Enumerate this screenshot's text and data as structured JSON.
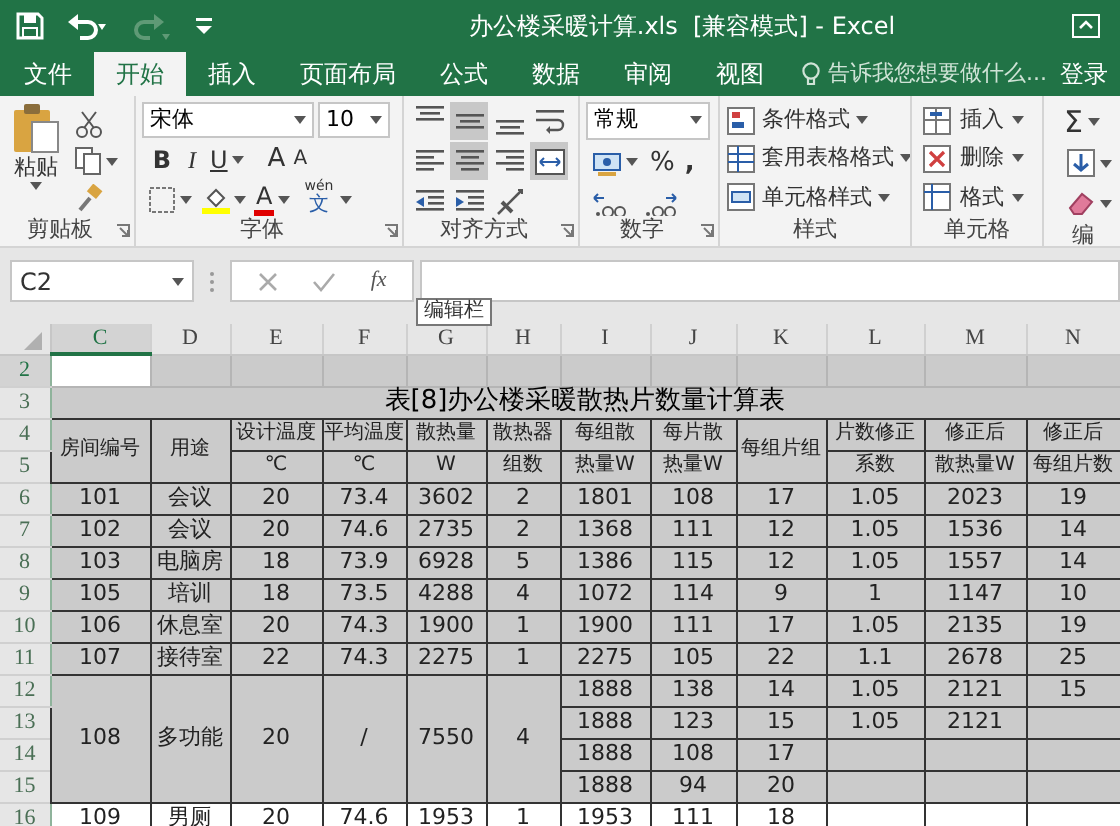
{
  "title_bar": {
    "title": "办公楼采暖计算.xls  [兼容模式] - Excel",
    "quick_access": [
      {
        "kind": "save",
        "disabled": false
      },
      {
        "kind": "undo",
        "disabled": false
      },
      {
        "kind": "redo",
        "disabled": true
      },
      {
        "kind": "customize",
        "disabled": false
      }
    ]
  },
  "tabs": [
    {
      "label": "文件",
      "selected": false
    },
    {
      "label": "开始",
      "selected": true
    },
    {
      "label": "插入",
      "selected": false
    },
    {
      "label": "页面布局",
      "selected": false
    },
    {
      "label": "公式",
      "selected": false
    },
    {
      "label": "数据",
      "selected": false
    },
    {
      "label": "审阅",
      "selected": false
    },
    {
      "label": "视图",
      "selected": false
    }
  ],
  "tell_me": {
    "placeholder": "告诉我您想要做什么..."
  },
  "sign_in": "登录",
  "ribbon": {
    "clipboard": {
      "label": "剪贴板",
      "paste": "粘贴"
    },
    "font": {
      "label": "字体",
      "name": "宋体",
      "size": "10",
      "bold": "B",
      "italic": "I",
      "underline": "U",
      "grow": "A",
      "shrink": "A",
      "font_color": "A",
      "phonetic_top": "wén",
      "phonetic_bottom": "文"
    },
    "alignment": {
      "label": "对齐方式",
      "buttons": [
        {
          "kind": "top",
          "selected": false
        },
        {
          "kind": "middle",
          "selected": true
        },
        {
          "kind": "bottom",
          "selected": false
        },
        {
          "kind": "wrap",
          "selected": false
        },
        {
          "kind": "left",
          "selected": false
        },
        {
          "kind": "center",
          "selected": true
        },
        {
          "kind": "right",
          "selected": false
        },
        {
          "kind": "merge",
          "selected": true
        },
        {
          "kind": "outdent",
          "selected": false
        },
        {
          "kind": "indent",
          "selected": false
        },
        {
          "kind": "orientation",
          "selected": false
        }
      ]
    },
    "number": {
      "label": "数字",
      "format": "常规",
      "percent": "%",
      "comma": ","
    },
    "styles": {
      "label": "样式",
      "items": [
        "条件格式",
        "套用表格格式",
        "单元格样式"
      ]
    },
    "cells": {
      "label": "单元格",
      "items": [
        "插入",
        "删除",
        "格式"
      ]
    },
    "editing": {
      "label": "编",
      "sum": "Σ"
    }
  },
  "formula_bar": {
    "name_box": "C2",
    "function_label": "fx"
  },
  "tooltip": "编辑栏",
  "sheet": {
    "columns": [
      "C",
      "D",
      "E",
      "F",
      "G",
      "H",
      "I",
      "J",
      "K",
      "L",
      "M",
      "N"
    ],
    "rows": [
      {
        "number": "2",
        "kind": "blank",
        "shaded": true,
        "cells": [
          {
            "selected": true
          },
          {
            "selected": false
          },
          {
            "selected": false
          },
          {
            "selected": false
          },
          {
            "selected": false
          },
          {
            "selected": false
          },
          {
            "selected": false
          },
          {
            "selected": false
          },
          {
            "selected": false
          },
          {
            "selected": false
          },
          {
            "selected": false
          },
          {
            "selected": false
          }
        ]
      },
      {
        "number": "3",
        "kind": "title",
        "shaded": true,
        "text": "表[8]办公楼采暖散热片数量计算表"
      },
      {
        "number": "4",
        "kind": "header",
        "shaded": true,
        "cells": [
          "房间编号",
          "用途",
          "设计温度",
          "平均温度",
          "散热量",
          "散热器",
          "每组散",
          "每片散",
          "每组片组",
          "片数修正",
          "修正后",
          "修正后"
        ]
      },
      {
        "number": "5",
        "kind": "header",
        "shaded": true,
        "cells": [
          {
            "merged": true
          },
          {
            "merged": true
          },
          "℃",
          "℃",
          "W",
          "组数",
          "热量W",
          "热量W",
          {
            "merged": true
          },
          "系数",
          "散热量W",
          "每组片数"
        ]
      },
      {
        "number": "6",
        "kind": "data",
        "shaded": true,
        "cells": [
          "101",
          "会议",
          "20",
          "73.4",
          "3602",
          "2",
          "1801",
          "108",
          "17",
          "1.05",
          "2023",
          "19"
        ]
      },
      {
        "number": "7",
        "kind": "data",
        "shaded": true,
        "cells": [
          "102",
          "会议",
          "20",
          "74.6",
          "2735",
          "2",
          "1368",
          "111",
          "12",
          "1.05",
          "1536",
          "14"
        ]
      },
      {
        "number": "8",
        "kind": "data",
        "shaded": true,
        "cells": [
          "103",
          "电脑房",
          "18",
          "73.9",
          "6928",
          "5",
          "1386",
          "115",
          "12",
          "1.05",
          "1557",
          "14"
        ]
      },
      {
        "number": "9",
        "kind": "data",
        "shaded": true,
        "cells": [
          "105",
          "培训",
          "18",
          "73.5",
          "4288",
          "4",
          "1072",
          "114",
          "9",
          "1",
          "1147",
          "10"
        ]
      },
      {
        "number": "10",
        "kind": "data",
        "shaded": true,
        "cells": [
          "106",
          "休息室",
          "20",
          "74.3",
          "1900",
          "1",
          "1900",
          "111",
          "17",
          "1.05",
          "2135",
          "19"
        ]
      },
      {
        "number": "11",
        "kind": "data",
        "shaded": true,
        "cells": [
          "107",
          "接待室",
          "22",
          "74.3",
          "2275",
          "1",
          "2275",
          "105",
          "22",
          "1.1",
          "2678",
          "25"
        ]
      },
      {
        "number": "12",
        "kind": "data",
        "shaded": true,
        "cells": [
          "108",
          "多功能",
          "20",
          "/",
          "7550",
          "4",
          "1888",
          "138",
          "14",
          "1.05",
          "2121",
          "15"
        ]
      },
      {
        "number": "13",
        "kind": "data",
        "shaded": true,
        "cells": [
          {
            "merged": true
          },
          {
            "merged": true
          },
          {
            "merged": true
          },
          {
            "merged": true
          },
          {
            "merged": true
          },
          {
            "merged": true
          },
          "1888",
          "123",
          "15",
          "1.05",
          "2121",
          null
        ]
      },
      {
        "number": "14",
        "kind": "data",
        "shaded": true,
        "cells": [
          {
            "merged": true
          },
          {
            "merged": true
          },
          {
            "merged": true
          },
          {
            "merged": true
          },
          {
            "merged": true
          },
          {
            "merged": true
          },
          "1888",
          "108",
          "17",
          null,
          null,
          null
        ]
      },
      {
        "number": "15",
        "kind": "data",
        "shaded": true,
        "cells": [
          {
            "merged": true
          },
          {
            "merged": true
          },
          {
            "merged": true
          },
          {
            "merged": true
          },
          {
            "merged": true
          },
          {
            "merged": true
          },
          "1888",
          "94",
          "20",
          null,
          null,
          null
        ]
      },
      {
        "number": "16",
        "kind": "data",
        "shaded": false,
        "cells": [
          "109",
          "男厕",
          "20",
          "74.6",
          "1953",
          "1",
          "1953",
          "111",
          "18",
          null,
          null,
          null
        ]
      }
    ]
  }
}
